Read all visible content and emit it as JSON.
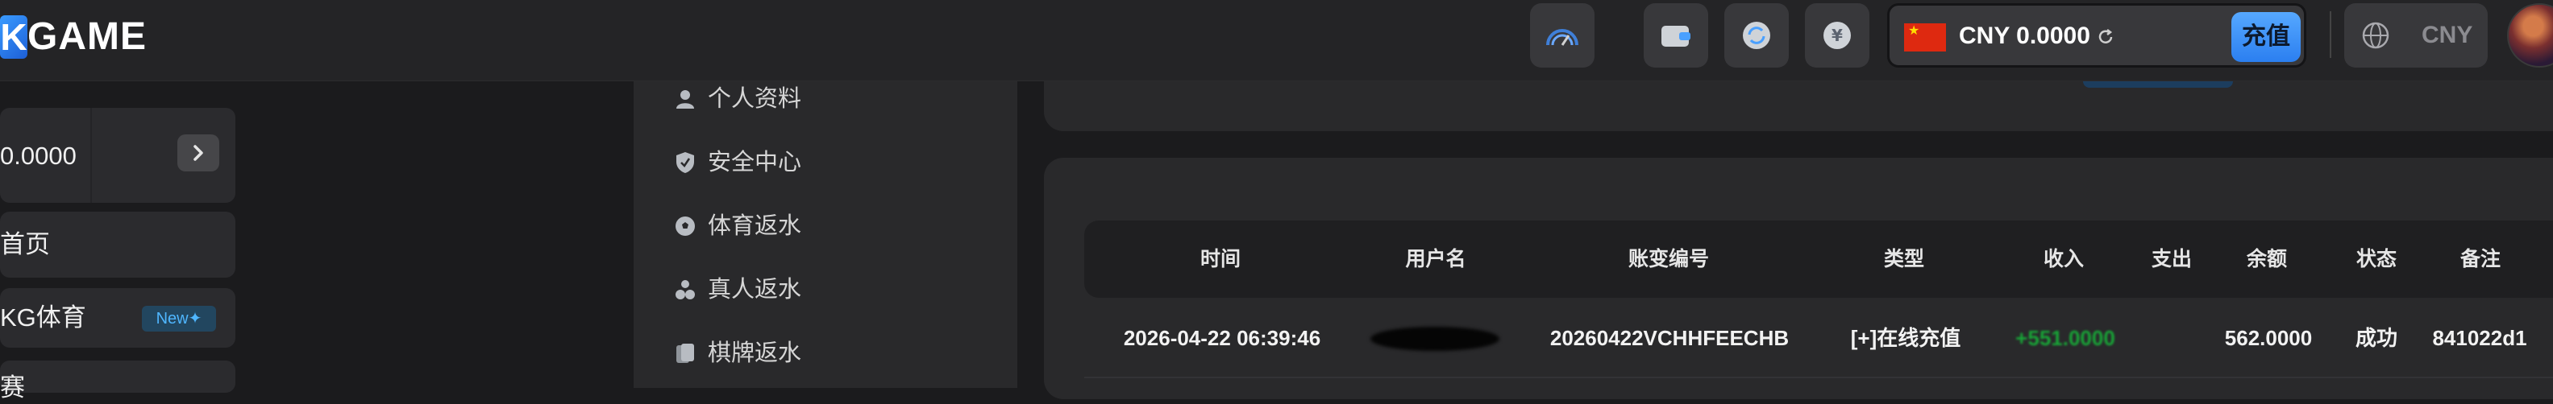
{
  "header": {
    "logo_k": "K",
    "logo_word": "GAME",
    "balance": "CNY 0.0000",
    "deposit_label": "充值",
    "currency": "CNY"
  },
  "sidebar": {
    "wallet_value": "0.0000",
    "items": [
      {
        "label": "首页"
      },
      {
        "label": "KG体育",
        "badge": "New"
      },
      {
        "label": "赛"
      }
    ]
  },
  "menu": {
    "items": [
      {
        "label": "个人资料",
        "icon": "user-icon"
      },
      {
        "label": "安全中心",
        "icon": "shield-icon"
      },
      {
        "label": "体育返水",
        "icon": "soccer-ball-icon"
      },
      {
        "label": "真人返水",
        "icon": "dealer-icon"
      },
      {
        "label": "棋牌返水",
        "icon": "cards-icon"
      }
    ]
  },
  "table": {
    "columns": [
      "时间",
      "用户名",
      "账变编号",
      "类型",
      "收入",
      "支出",
      "余额",
      "状态",
      "备注"
    ],
    "rows": [
      {
        "time": "2026-04-22 06:39:46",
        "username": "",
        "serial": "20260422VCHHFEECHB",
        "type": "[+]在线充值",
        "income": "+551.0000",
        "expense": "",
        "balance": "562.0000",
        "status": "成功",
        "remark": "841022d1"
      }
    ]
  },
  "colors": {
    "background": "#1b1b1d",
    "panel": "#29292b",
    "accent": "#2b7ff0",
    "income": "#18a537"
  }
}
